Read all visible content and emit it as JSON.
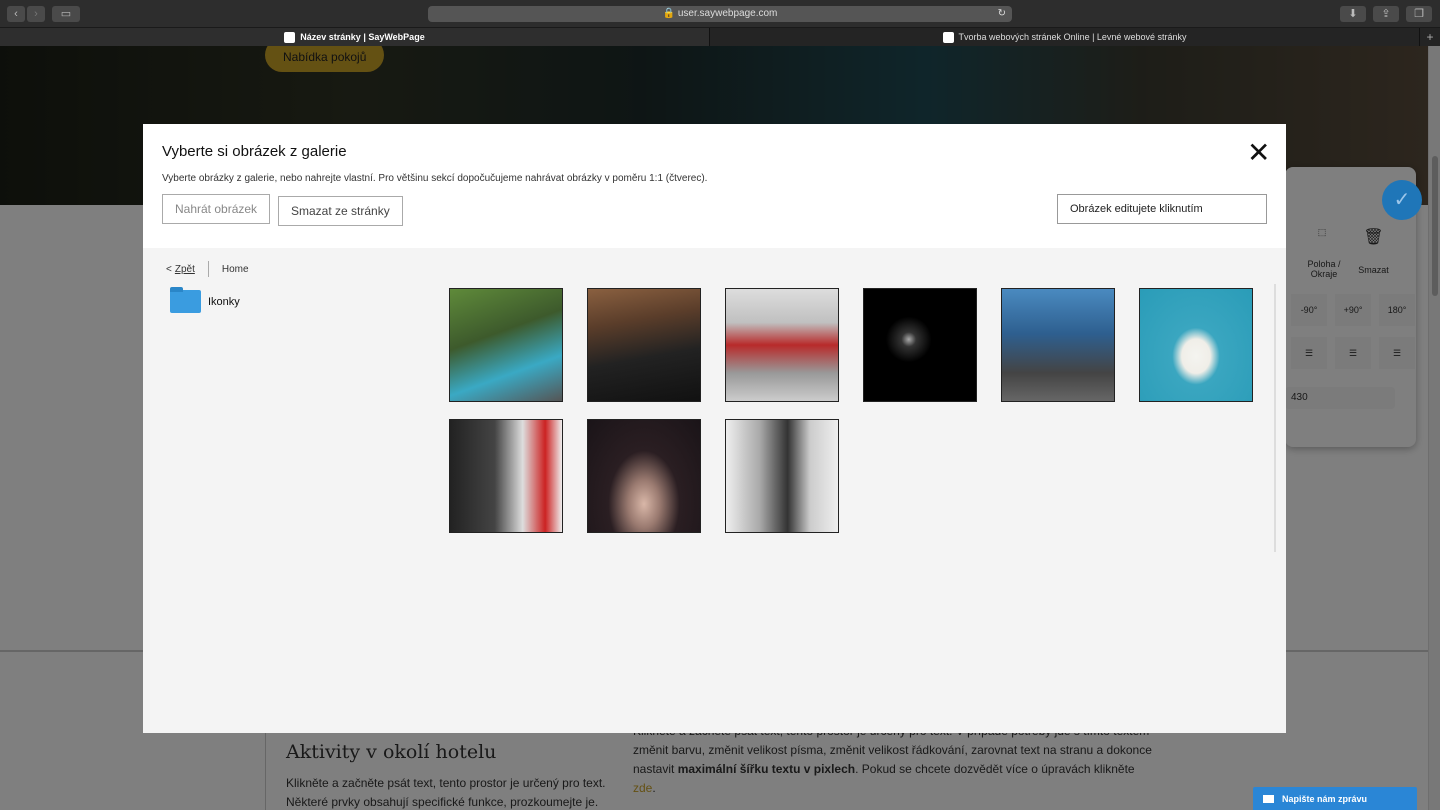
{
  "browser": {
    "url": "user.saywebpage.com",
    "tabs": [
      "Název stránky | SayWebPage",
      "Tvorba webových stránek Online | Levné webové stránky"
    ]
  },
  "page": {
    "hero_button": "Nabídka pokojů",
    "heading": "Aktivity v okolí hotelu",
    "para1": "Klikněte a začněte psát text, tento prostor je určený pro text. Některé prvky obsahují specifické funkce, prozkoumejte je.",
    "para2_top": "Klikněte a začněte psát text, tento prostor je určený pro text. V případě potřeby jde s tímto textem",
    "para2_a": "změnit barvu, změnit velikost písma, změnit velikost řádkování, zarovnat text na stranu a dokonce nastavit ",
    "para2_bold": "maximální šířku textu v pixlech",
    "para2_b": ". Pokud se chcete dozvědět více o úpravách klikněte ",
    "para2_link": "zde",
    "para2_end": "."
  },
  "editor": {
    "position_label": "Poloha / Okraje",
    "delete_label": "Smazat",
    "rotate": [
      "-90°",
      "+90°",
      "180°"
    ],
    "width_value": "430"
  },
  "modal": {
    "title": "Vyberte si obrázek z galerie",
    "subtitle": "Vyberte obrázky z galerie, nebo nahrejte vlastní. Pro většinu sekcí dopočučujeme nahrávat obrázky v poměru 1:1 (čtverec).",
    "upload_label": "Nahrát obrázek",
    "remove_label": "Smazat ze stránky",
    "edit_hint": "Obrázek editujete kliknutím",
    "back_label": "Zpět",
    "breadcrumb_home": "Home",
    "folder_name": "Ikonky",
    "images": [
      "pool-villa",
      "wine-corks",
      "car-workshop",
      "dark-light",
      "mechanic-engine",
      "birthday-cake",
      "tire-change",
      "woman-hat",
      "hair-salon"
    ]
  },
  "chat": {
    "label": "Napište nám zprávu"
  },
  "colors": {
    "accent": "#c9a227",
    "blue": "#2a86d6"
  }
}
